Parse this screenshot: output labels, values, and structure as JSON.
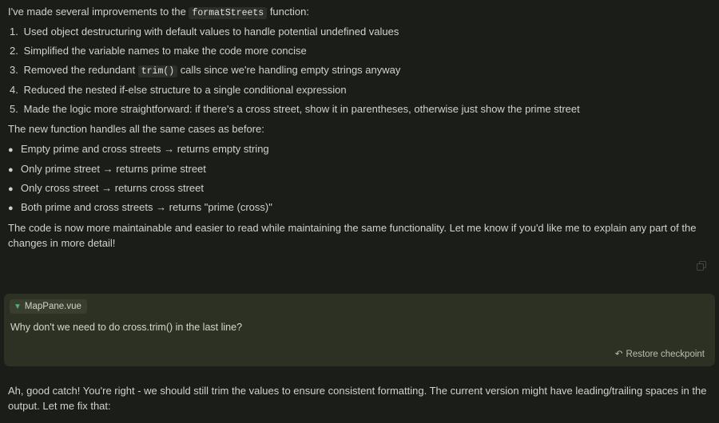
{
  "intro": {
    "before": "I've made several improvements to the ",
    "code": "formatStreets",
    "after": " function:"
  },
  "improvements": [
    {
      "num": "1.",
      "text": "Used object destructuring with default values to handle potential undefined values"
    },
    {
      "num": "2.",
      "text": "Simplified the variable names to make the code more concise"
    },
    {
      "num": "3.",
      "before": "Removed the redundant ",
      "code": "trim()",
      "after": " calls since we're handling empty strings anyway"
    },
    {
      "num": "4.",
      "text": "Reduced the nested if-else structure to a single conditional expression"
    },
    {
      "num": "5.",
      "text": "Made the logic more straightforward: if there's a cross street, show it in parentheses, otherwise just show the prime street"
    }
  ],
  "cases_intro": "The new function handles all the same cases as before:",
  "cases": [
    "Empty prime and cross streets → returns empty string",
    "Only prime street → returns prime street",
    "Only cross street → returns cross street",
    "Both prime and cross streets → returns \"prime (cross)\""
  ],
  "conclusion": "The code is now more maintainable and easier to read while maintaining the same functionality. Let me know if you'd like me to explain any part of the changes in more detail!",
  "user_turn": {
    "file_chip": "MapPane.vue",
    "message": "Why don't we need to do cross.trim() in the last line?",
    "restore_label": "Restore checkpoint"
  },
  "answer": "Ah, good catch! You're right - we should still trim the values to ensure consistent formatting. The current version might have leading/trailing spaces in the output. Let me fix that:",
  "icons": {
    "copy": "copy-icon",
    "file_toggle": "triangle-down-icon",
    "restore": "restore-icon"
  },
  "colors": {
    "background": "#1b1d19",
    "user_box": "#2d3123",
    "accent_green": "#4caf75"
  }
}
